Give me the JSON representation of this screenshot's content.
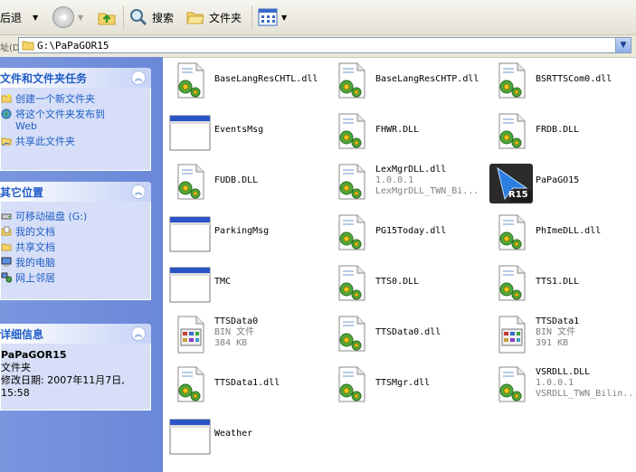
{
  "toolbar": {
    "back_label": "后退",
    "search_label": "搜索",
    "folders_label": "文件夹"
  },
  "address": {
    "label": "址(D)",
    "path": "G:\\PaPaGOR15"
  },
  "tasks": {
    "title": "文件和文件夹任务",
    "items": [
      "创建一个新文件夹",
      "将这个文件夹发布到",
      "Web",
      "共享此文件夹"
    ]
  },
  "places": {
    "title": "其它位置",
    "items": [
      "可移动磁盘 (G:)",
      "我的文档",
      "共享文档",
      "我的电脑",
      "网上邻居"
    ]
  },
  "details": {
    "title": "详细信息",
    "name": "PaPaGOR15",
    "type": "文件夹",
    "modified": "修改日期: 2007年11月7日,",
    "time": "15:58"
  },
  "files": [
    {
      "name": "BaseLangResCHTL.dll",
      "icon": "dll-icon"
    },
    {
      "name": "BaseLangResCHTP.dll",
      "icon": "dll-icon"
    },
    {
      "name": "BSRTTSCom0.dll",
      "icon": "dll-icon"
    },
    {
      "name": "EventsMsg",
      "icon": "window-icon"
    },
    {
      "name": "FHWR.DLL",
      "icon": "dll-icon"
    },
    {
      "name": "FRDB.DLL",
      "icon": "dll-icon"
    },
    {
      "name": "FUDB.DLL",
      "icon": "dll-icon"
    },
    {
      "name": "LexMgrDLL.dll",
      "sub1": "1.0.0.1",
      "sub2": "LexMgrDLL_TWN_Bi...",
      "icon": "dll-icon"
    },
    {
      "name": "PaPaGO15",
      "icon": "papago-icon"
    },
    {
      "name": "ParkingMsg",
      "icon": "window-icon"
    },
    {
      "name": "PG15Today.dll",
      "icon": "dll-icon"
    },
    {
      "name": "PhImeDLL.dll",
      "icon": "dll-icon"
    },
    {
      "name": "TMC",
      "icon": "window-icon"
    },
    {
      "name": "TTS0.DLL",
      "icon": "dll-icon"
    },
    {
      "name": "TTS1.DLL",
      "icon": "dll-icon"
    },
    {
      "name": "TTSData0",
      "sub1": "BIN 文件",
      "sub2": "384 KB",
      "icon": "bin-icon"
    },
    {
      "name": "TTSData0.dll",
      "icon": "dll-icon"
    },
    {
      "name": "TTSData1",
      "sub1": "BIN 文件",
      "sub2": "391 KB",
      "icon": "bin-icon"
    },
    {
      "name": "TTSData1.dll",
      "icon": "dll-icon"
    },
    {
      "name": "TTSMgr.dll",
      "icon": "dll-icon"
    },
    {
      "name": "VSRDLL.DLL",
      "sub1": "1.0.0.1",
      "sub2": "VSRDLL_TWN_Bilin...",
      "icon": "dll-icon"
    },
    {
      "name": "Weather",
      "icon": "window-icon"
    }
  ]
}
